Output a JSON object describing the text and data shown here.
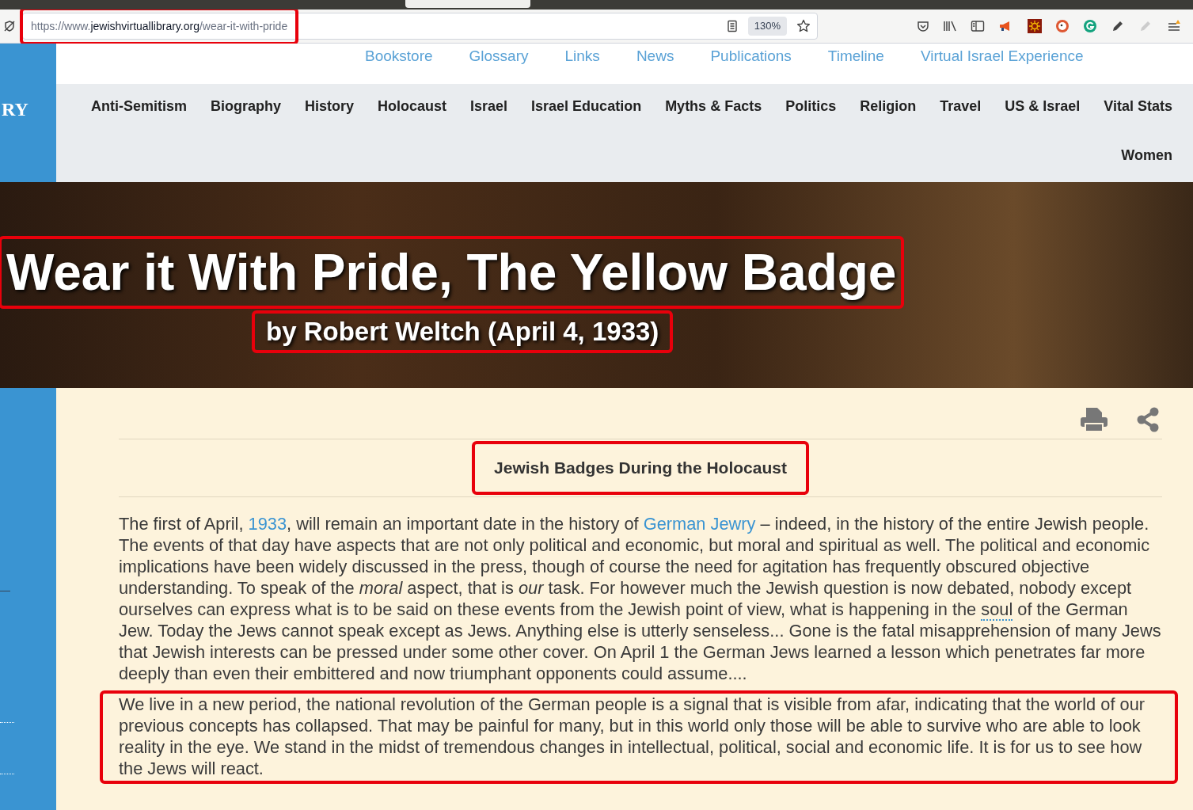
{
  "browser": {
    "url_prefix": "https://www.",
    "url_domain": "jewishvirtuallibrary.org",
    "url_path": "/wear-it-with-pride",
    "url_highlighted": true,
    "zoom": "130%"
  },
  "site": {
    "logo_fragment": "RY",
    "top_links": [
      "Bookstore",
      "Glossary",
      "Links",
      "News",
      "Publications",
      "Timeline",
      "Virtual Israel Experience"
    ],
    "nav": [
      {
        "label": "Anti-Semitism"
      },
      {
        "label": "Biography"
      },
      {
        "label": "History"
      },
      {
        "label": "Holocaust"
      },
      {
        "label": "Israel"
      },
      {
        "label": "Israel Education"
      },
      {
        "label": "Myths & Facts"
      },
      {
        "label": "Politics"
      },
      {
        "label": "Religion"
      },
      {
        "label": "Travel"
      },
      {
        "label": "US & Israel"
      },
      {
        "label": "Vital Stats"
      },
      {
        "label": "Women"
      }
    ]
  },
  "hero": {
    "title": "Wear it With Pride, The Yellow Badge",
    "title_highlighted": true,
    "byline": "by Robert Weltch (April 4, 1933)",
    "byline_highlighted": true
  },
  "article": {
    "section_heading": "Jewish Badges During the Holocaust",
    "heading_highlighted": true,
    "paragraphs": [
      {
        "highlighted": false,
        "segments": [
          {
            "kind": "text",
            "text": "The first of April, "
          },
          {
            "kind": "link",
            "text": "1933"
          },
          {
            "kind": "text",
            "text": ", will remain an important date in the history of "
          },
          {
            "kind": "link",
            "text": "German Jewry"
          },
          {
            "kind": "text",
            "text": " – indeed, in the history of the entire Jewish people. The events of that day have aspects that are not only political and economic, but moral and spiritual as well. The political and economic implications have been widely discussed in the press, though of course the need for agitation has frequently obscured objective understanding. To speak of the *moral* aspect, that is *our* task. For however much the Jewish question is now debated, nobody except ourselves can express what is to be said on these events from the Jewish point of view, what is happening in the "
          },
          {
            "kind": "glossary",
            "text": "soul"
          },
          {
            "kind": "text",
            "text": " of the German Jew. Today the Jews cannot speak except as Jews. Anything else is utterly senseless... Gone is the fatal misapprehension of many Jews that Jewish interests can be pressed under some other cover. On April 1 the German Jews learned a lesson which penetrates far more deeply than even their embittered and now triumphant opponents could assume...."
          }
        ]
      },
      {
        "highlighted": true,
        "segments": [
          {
            "kind": "text",
            "text": "We live in a new period, the national revolution of the German people is a signal that is visible from afar, indicating that the world of our previous concepts has collapsed. That may be painful for many, but in this world only those will be able to survive who are able to look reality in the eye. We stand in the midst of tremendous changes in intellectual, political, social and economic life. It is for us to see how the Jews will react."
          }
        ]
      }
    ]
  }
}
